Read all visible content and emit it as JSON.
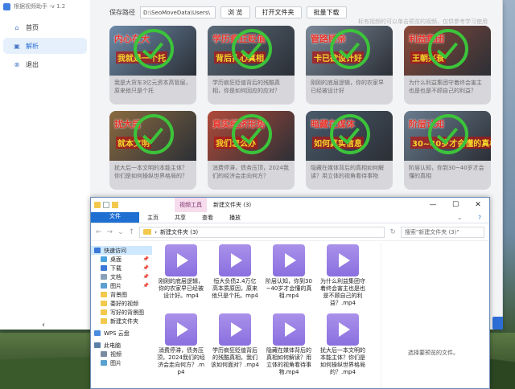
{
  "app": {
    "title": "根据视频助手 -v 1.2",
    "sidebar": [
      {
        "icon": "home-icon",
        "glyph": "⌂",
        "label": "首页",
        "active": false
      },
      {
        "icon": "parse-icon",
        "glyph": "▣",
        "label": "解析",
        "active": true
      },
      {
        "icon": "exit-icon",
        "glyph": "⊗",
        "label": "退出",
        "active": false
      }
    ],
    "collapse_glyph": "‹"
  },
  "toolbar": {
    "save_path_label": "保存路径",
    "save_path_value": "D:\\SeoMoveData\\Users\\",
    "choose_button": "浏 览",
    "open_folder_button": "打开文件夹",
    "batch_download_button": "批量下载",
    "hint": "标有视频的可以单击预览的视频，仅供参考学习使用"
  },
  "cards": [
    {
      "top_text": "内心在大",
      "bottom_text": "我就是一个托",
      "caption": "我是大货车3亿元资本高管层，原来他只是个托",
      "bg": "#6d8aa8"
    },
    {
      "top_text": "学历疯狂贬值",
      "bottom_text": "背后扎心真相",
      "caption": "学历疯狂贬值背后的残酷真相，你是如何回应的应对？",
      "bg": "#5a6a78"
    },
    {
      "top_text": "管路顾亲",
      "bottom_text": "卡已欲设计好",
      "caption": "刚刚的底层逻辑，你的农家早已经被设计好",
      "bg": "#7a8898"
    },
    {
      "top_text": "利益集团",
      "bottom_text": "王朝兴衰",
      "caption": "为什么利益集团守着终会害主也是也是不顾自己的利益？",
      "bg": "#8a4a3a"
    },
    {
      "top_text": "扰大后",
      "bottom_text": "就本文明",
      "caption": "扰大后一本文明的本能主体？你们是如何操纵世界格局的？",
      "bg": "#8a6a40"
    },
    {
      "top_text": "真实经济形势",
      "bottom_text": "我们怎么办",
      "caption": "消费停滞，债务压顶，2024我们的经济会走向何方？",
      "bg": "#b04a3a"
    },
    {
      "top_text": "暗藏在媒体",
      "bottom_text": "如何真实信息",
      "caption": "隐藏在媒体背后的真相如何解读？用立体的视角看待事物",
      "bg": "#4a5a6a"
    },
    {
      "top_text": "阶层认知",
      "bottom_text": "30~40岁才会懂的真相",
      "caption": "阶层认知，你到30~40岁才会懂的真相",
      "bg": "#6a7c8e"
    }
  ],
  "explorer": {
    "context_tab": "视频工具",
    "title": "新建文件夹 (3)",
    "window_buttons": {
      "minimize": "—",
      "maximize": "☐",
      "close": "✕"
    },
    "ribbon": {
      "file": "文件",
      "home": "主页",
      "share": "共享",
      "view": "查看",
      "play": "播放",
      "collapse": "⌄",
      "help": "?"
    },
    "address": "新建文件夹 (3)",
    "search_placeholder": "搜索\"新建文件夹 (3)\"",
    "nav": [
      {
        "label": "快速访问",
        "head": true,
        "color": "#3c78d8",
        "pin": false
      },
      {
        "label": "桌面",
        "head": false,
        "color": "#4aa3df",
        "pin": true
      },
      {
        "label": "下载",
        "head": false,
        "color": "#3c78d8",
        "pin": true
      },
      {
        "label": "文档",
        "head": false,
        "color": "#8aa0b8",
        "pin": true
      },
      {
        "label": "图片",
        "head": false,
        "color": "#5aa0d0",
        "pin": true
      },
      {
        "label": "背景图",
        "head": false,
        "color": "#f2c94c",
        "pin": false
      },
      {
        "label": "委好的视频",
        "head": false,
        "color": "#f2c94c",
        "pin": false
      },
      {
        "label": "写好的背景图",
        "head": false,
        "color": "#f2c94c",
        "pin": false
      },
      {
        "label": "新建文件夹",
        "head": false,
        "color": "#f2c94c",
        "pin": false
      },
      {
        "label": "WPS 云盘",
        "head": true,
        "color": "#4a8be0",
        "pin": false
      },
      {
        "label": "此电脑",
        "head": true,
        "color": "#5a7fa8",
        "pin": false
      },
      {
        "label": "视频",
        "head": false,
        "color": "#7a8aa0",
        "pin": false
      },
      {
        "label": "图片",
        "head": false,
        "color": "#5aa0d0",
        "pin": false
      }
    ],
    "files": [
      "刚刚的底层逻辑，你的农家早已经被设计好。mp4",
      "恒大负债2.4万亿高本质原因，原来他只是个托。mp4",
      "阶层认知，你到30~40岁才会懂的真相.mp4",
      "为什么利益集团守着终会害主也是也是不顾自己的利益？.mp4",
      "消费停滞，债务压顶，2024我们的经济会走向何方？.mp4",
      "学历疯狂贬值背后的残酷真相，我们该如何面对？.mp4",
      "隐藏在媒体背后的真相如何解读？用立体的视角看待事物.mp4",
      "扰大后一本文明的本能主体？你们是如何操纵世界格局的？.mp4"
    ],
    "preview_message": "选择要预览的文件。"
  }
}
